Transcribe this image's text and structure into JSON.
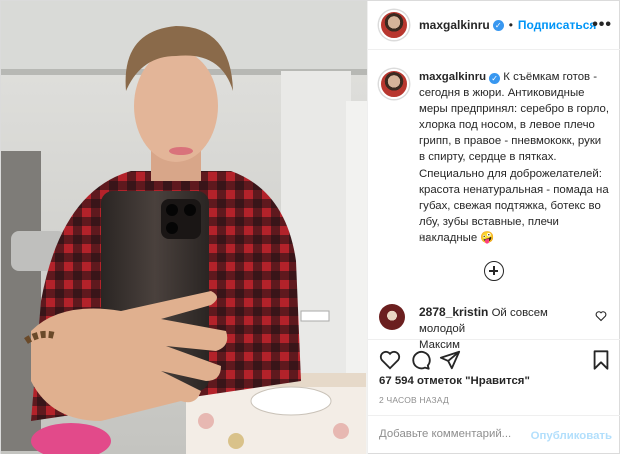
{
  "colors": {
    "accent": "#0095f6",
    "verified": "#3897f0",
    "muted": "#8e8e8e",
    "publish_disabled": "#b2dffc"
  },
  "photo": {
    "description_icon": "selfie-photo"
  },
  "header": {
    "username": "maxgalkinru",
    "verified_icon": "verified-badge-icon",
    "separator": "•",
    "follow_label": "Подписаться",
    "more_icon": "more-options-icon"
  },
  "caption": {
    "username": "maxgalkinru",
    "lines": [
      "К съёмкам готов -",
      "сегодня в жюри. Антиковидные",
      "меры предпринял: серебро в горло,",
      "хлорка под носом, в левое плечо",
      "грипп, в правое - пневмококк, руки",
      "в спирту, сердце в пятках.",
      "Специально для доброжелателей:",
      "красота ненатуральная - помада на",
      "губах, свежая подтяжка, ботекс во",
      "лбу, зубы вставные, плечи",
      "накладные 🤪"
    ],
    "time": "2 ч."
  },
  "load_more_icon": "plus-circle-icon",
  "comment": {
    "username": "2878_kristin",
    "text_line1": "Ой совсем молодой",
    "text_line2": "Максим"
  },
  "actions": [
    "like-icon",
    "comment-icon",
    "share-icon",
    "save-icon"
  ],
  "likes": "67 594 отметок \"Нравится\"",
  "timestamp": "2 ЧАСОВ НАЗАД",
  "add_comment": {
    "placeholder": "Добавьте комментарий...",
    "publish_label": "Опубликовать"
  }
}
